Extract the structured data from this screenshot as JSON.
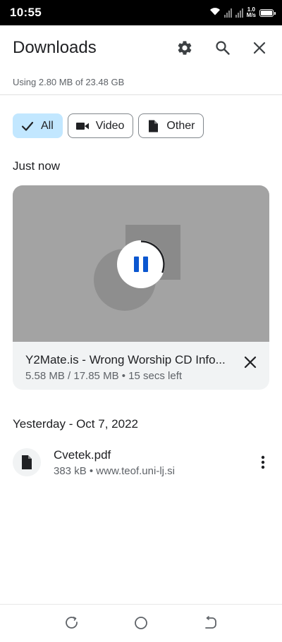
{
  "status_bar": {
    "time": "10:55",
    "speed_value": "1.0",
    "speed_unit": "M/s",
    "icons": [
      "wifi-icon",
      "signal-icon",
      "signal-icon",
      "battery-icon"
    ]
  },
  "header": {
    "title": "Downloads",
    "usage": "Using 2.80 MB of 23.48 GB",
    "actions": [
      "gear-icon",
      "search-icon",
      "close-icon"
    ]
  },
  "filters": [
    {
      "label": "All",
      "icon": "check-icon",
      "selected": true
    },
    {
      "label": "Video",
      "icon": "videocam-icon",
      "selected": false
    },
    {
      "label": "Other",
      "icon": "file-icon",
      "selected": false
    }
  ],
  "sections": {
    "recent": {
      "label": "Just now",
      "download": {
        "name": "Y2Mate.is - Wrong Worship CD Info...",
        "meta": "5.58 MB / 17.85 MB • 15 secs left",
        "progress": 0.31
      }
    },
    "yesterday": {
      "label": "Yesterday - Oct 7, 2022",
      "file": {
        "name": "Cvetek.pdf",
        "meta": "383 kB • www.teof.uni-lj.si"
      }
    }
  },
  "colors": {
    "accent": "#0b57d0",
    "chip_selected": "#c2e7ff",
    "thumbnail": "#a3a3a3",
    "secondary_text": "#5f6368"
  },
  "nav_bar": [
    "recents-icon",
    "home-icon",
    "back-icon"
  ]
}
